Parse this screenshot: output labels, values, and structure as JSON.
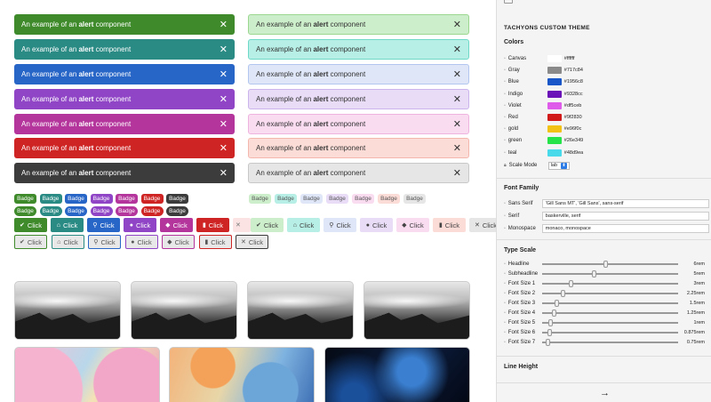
{
  "alerts": {
    "prefix": "An example of an ",
    "bold": "alert",
    "suffix": " component",
    "close": "✕",
    "solid_colors": [
      "#3f8b2c",
      "#2a8a84",
      "#2765c7",
      "#8f45c6",
      "#b4359c",
      "#cf2424",
      "#3c3c3c"
    ],
    "light_bg": [
      "#cdeecb",
      "#b7efe6",
      "#dfe6f8",
      "#e8dcf7",
      "#fadcf1",
      "#fcdcd7",
      "#e6e6e6"
    ],
    "light_border": [
      "#9bd78f",
      "#6fd9c8",
      "#b3c6ef",
      "#cbb3ec",
      "#efb3e0",
      "#f4b7ae",
      "#c8c8c8"
    ]
  },
  "badges": {
    "label": "Badge",
    "solid": [
      "#3f8b2c",
      "#2a8a84",
      "#2765c7",
      "#8f45c6",
      "#b4359c",
      "#cf2424",
      "#3c3c3c"
    ],
    "light": [
      "#cdeecb",
      "#b7efe6",
      "#dfe6f8",
      "#e8dcf7",
      "#fadcf1",
      "#fcdcd7",
      "#e6e6e6"
    ]
  },
  "buttons": {
    "label": "Click",
    "icons": [
      "✔",
      "⌂",
      "⚲",
      "●",
      "◆",
      "▮",
      "✕"
    ],
    "solid": [
      "#3f8b2c",
      "#2a8a84",
      "#2765c7",
      "#8f45c6",
      "#b4359c",
      "#cf2424"
    ],
    "light": [
      "#cdeecb",
      "#b7efe6",
      "#dfe6f8",
      "#e8dcf7",
      "#fadcf1",
      "#fcdcd7",
      "#e6e6e6"
    ],
    "outline_border": [
      "#3f8b2c",
      "#2a8a84",
      "#2765c7",
      "#8f45c6",
      "#b4359c",
      "#cf2424",
      "#3c3c3c"
    ]
  },
  "sidebar": {
    "title": "TACHYONS CUSTOM THEME",
    "colors_heading": "Colors",
    "colors": [
      {
        "name": "Canvas",
        "hex": "#ffffff",
        "swatch": "#ffffff"
      },
      {
        "name": "Gray",
        "hex": "#717c84",
        "swatch": "#8a8a8a"
      },
      {
        "name": "Blue",
        "hex": "#1956c8",
        "swatch": "#1956c8"
      },
      {
        "name": "Indigo",
        "hex": "#9328cc",
        "swatch": "#6a11b8"
      },
      {
        "name": "Violet",
        "hex": "#df5ceb",
        "swatch": "#df5ceb"
      },
      {
        "name": "Red",
        "hex": "#9f2830",
        "swatch": "#d11a1a"
      },
      {
        "name": "gold",
        "hex": "#e96f0c",
        "swatch": "#f2c316"
      },
      {
        "name": "green",
        "hex": "#26e349",
        "swatch": "#26e349"
      },
      {
        "name": "teal",
        "hex": "#48d9ea",
        "swatch": "#48d9ea"
      }
    ],
    "scale_mode_label": "Scale Mode",
    "scale_mode_value": "lab",
    "font_family_heading": "Font Family",
    "fonts": [
      {
        "name": "Sans Serif",
        "value": "'Gill Sans MT', 'Gill Sans', sans-serif"
      },
      {
        "name": "Serif",
        "value": "baskerville, serif"
      },
      {
        "name": "Monospace",
        "value": "monaco, monospace"
      }
    ],
    "type_scale_heading": "Type Scale",
    "scale": [
      {
        "name": "Headline",
        "value": "6rem",
        "pos": 0.45
      },
      {
        "name": "Subheadline",
        "value": "5rem",
        "pos": 0.37
      },
      {
        "name": "Font Size 1",
        "value": "3rem",
        "pos": 0.2
      },
      {
        "name": "Font Size 2",
        "value": "2.25rem",
        "pos": 0.14
      },
      {
        "name": "Font Size 3",
        "value": "1.5rem",
        "pos": 0.09
      },
      {
        "name": "Font Size 4",
        "value": "1.25rem",
        "pos": 0.07
      },
      {
        "name": "Font Size 5",
        "value": "1rem",
        "pos": 0.05
      },
      {
        "name": "Font Size 6",
        "value": "0.875rem",
        "pos": 0.04
      },
      {
        "name": "Font Size 7",
        "value": "0.75rem",
        "pos": 0.03
      }
    ],
    "line_height_heading": "Line Height",
    "next_icon": "→"
  }
}
